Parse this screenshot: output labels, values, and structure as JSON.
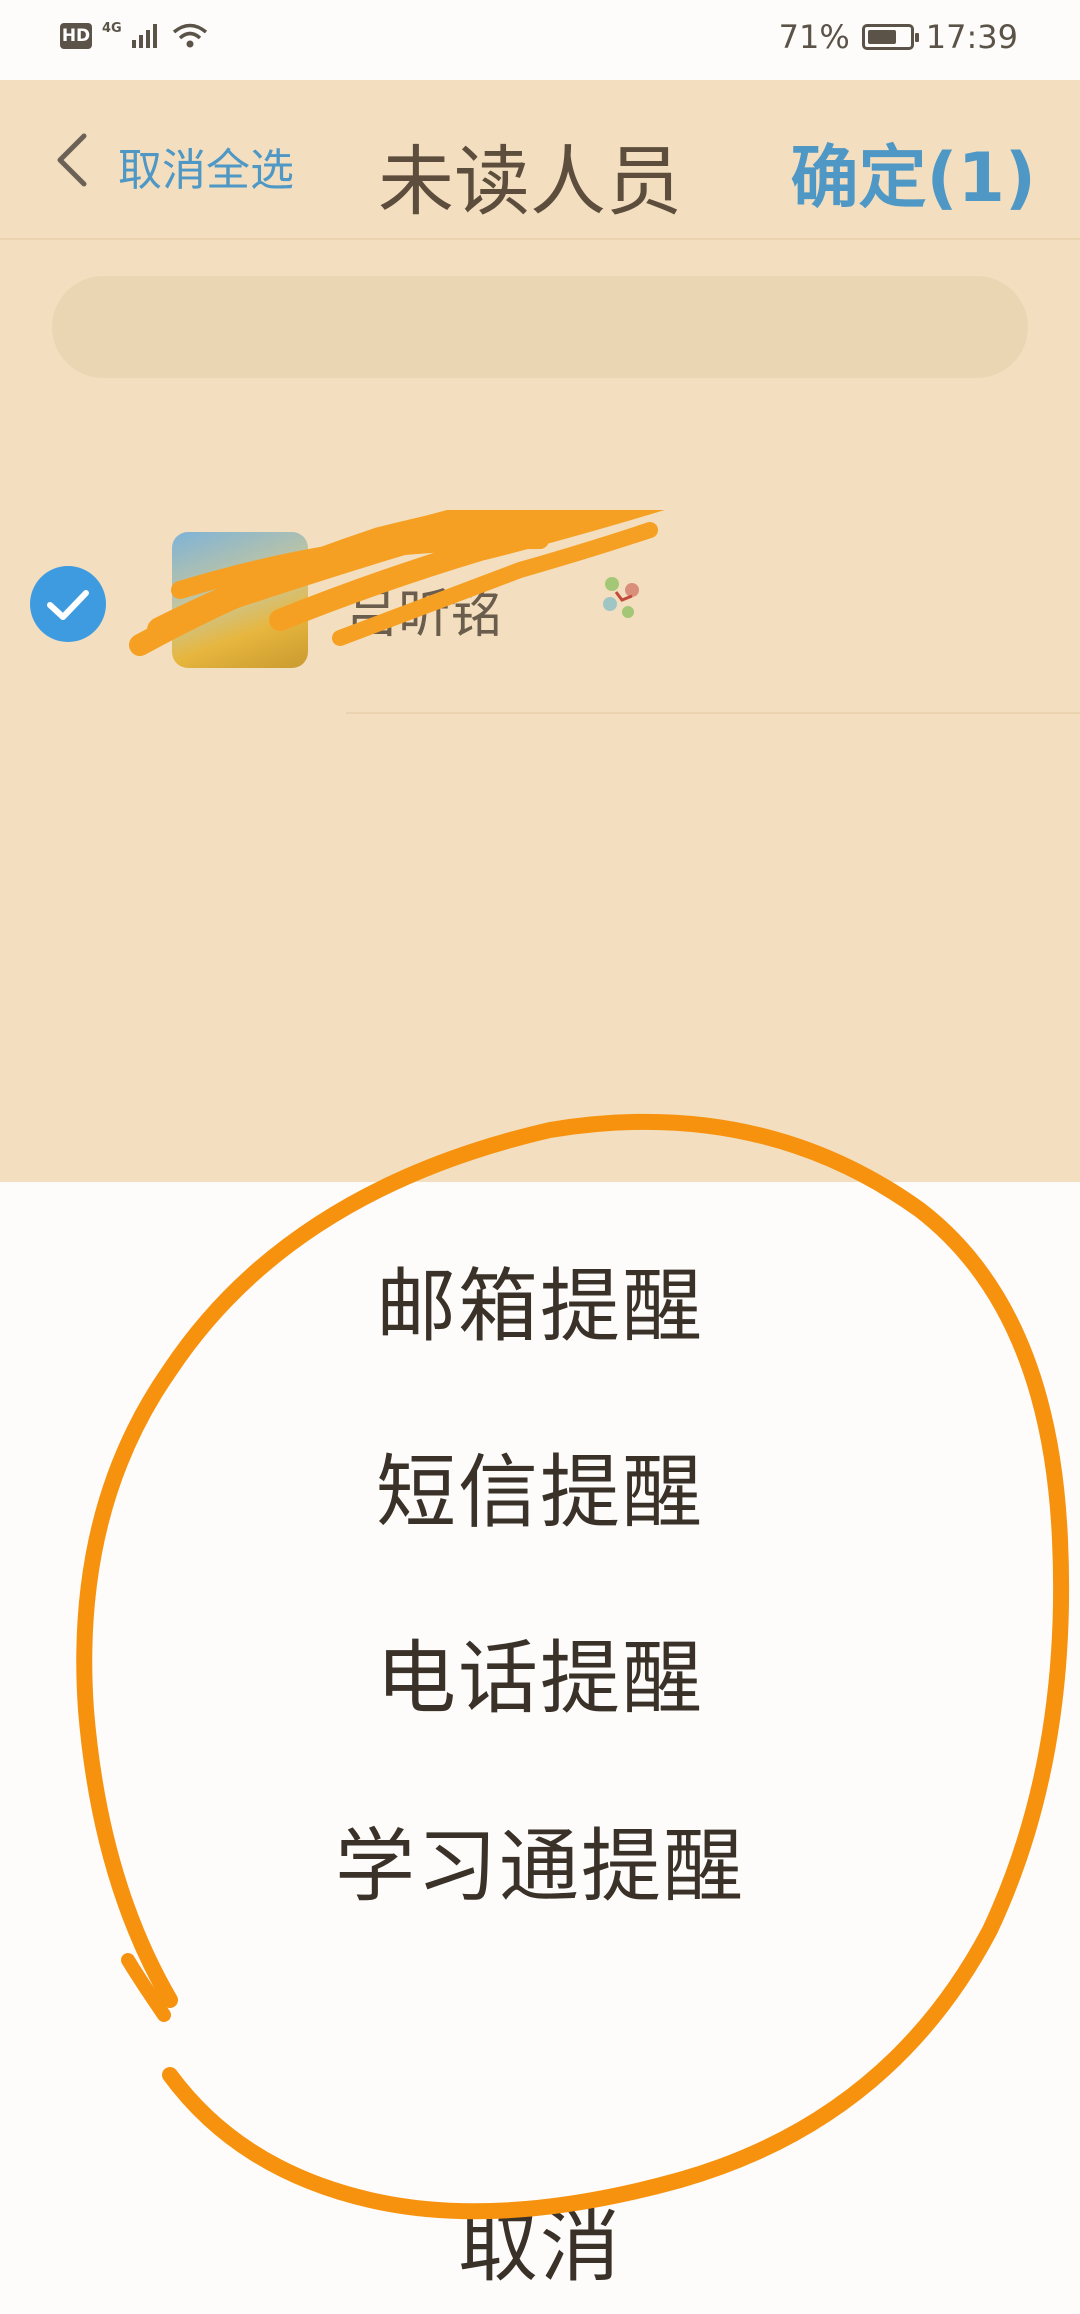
{
  "status_bar": {
    "hd_label": "HD",
    "network_label": "4G",
    "battery_percent": "71%",
    "battery_level": 0.71,
    "time": "17:39"
  },
  "header": {
    "back_icon": "chevron-left-icon",
    "cancel_select_all": "取消全选",
    "title": "未读人员",
    "confirm": "确定(1)"
  },
  "member_list": [
    {
      "checked": true,
      "name": "吕昕铭",
      "redacted": true
    }
  ],
  "action_sheet": {
    "options": [
      "邮箱提醒",
      "短信提醒",
      "电话提醒",
      "学习通提醒"
    ],
    "cancel": "取消"
  },
  "colors": {
    "accent_blue": "#4f97c5",
    "backdrop": "#f3dfbf",
    "annotation_orange": "#f7920f",
    "checkbox_blue": "#3f9be0"
  }
}
